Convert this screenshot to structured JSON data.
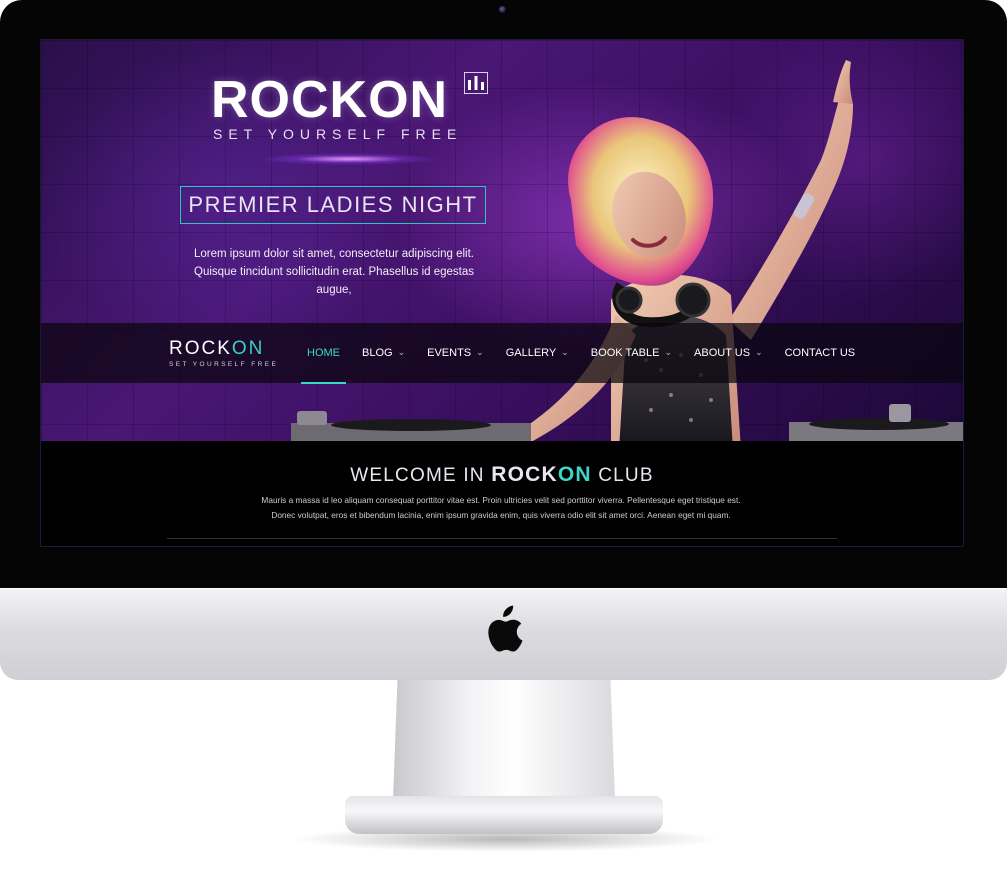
{
  "hero": {
    "logo_word": "ROCKON",
    "logo_tagline": "SET YOURSELF FREE",
    "promo_title": "PREMIER LADIES NIGHT",
    "intro_text": "Lorem ipsum dolor sit amet, consectetur adipiscing elit. Quisque tincidunt sollicitudin erat. Phasellus id egestas augue,"
  },
  "nav": {
    "logo_rock": "ROCK",
    "logo_on": "ON",
    "logo_tagline": "SET YOURSELF FREE",
    "items": [
      {
        "label": "HOME",
        "active": true,
        "has_dropdown": false
      },
      {
        "label": "BLOG",
        "active": false,
        "has_dropdown": true
      },
      {
        "label": "EVENTS",
        "active": false,
        "has_dropdown": true
      },
      {
        "label": "GALLERY",
        "active": false,
        "has_dropdown": true
      },
      {
        "label": "BOOK TABLE",
        "active": false,
        "has_dropdown": true
      },
      {
        "label": "ABOUT US",
        "active": false,
        "has_dropdown": true
      },
      {
        "label": "CONTACT US",
        "active": false,
        "has_dropdown": false
      }
    ],
    "chevron": "⌄"
  },
  "welcome": {
    "title_pre": "WELCOME IN",
    "title_rock": "ROCK",
    "title_on": "ON",
    "title_post": "CLUB",
    "body_line1": "Mauris a massa id leo aliquam consequat porttitor vitae est. Proin ultricies velit sed porttitor viverra. Pellentesque eget tristique est.",
    "body_line2": "Donec volutpat, eros et bibendum lacinia, enim ipsum gravida enim, quis viverra odio elit sit amet orci. Aenean eget mi quam."
  },
  "colors": {
    "accent": "#3bd6c7",
    "hero_purple": "#4a1775",
    "bezel": "#050505"
  },
  "icons": {
    "logo_mark": "equalizer-icon",
    "dropdown": "chevron-down-icon",
    "hardware": "apple-logo-icon"
  }
}
